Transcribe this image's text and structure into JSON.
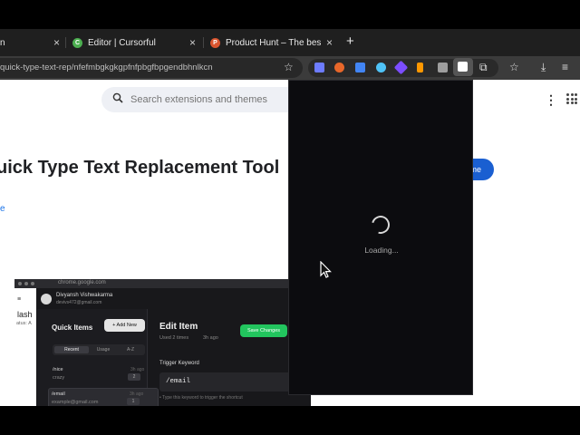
{
  "browser": {
    "tabs": [
      {
        "title": "n",
        "favicon_color": "#888888",
        "favicon_letter": ""
      },
      {
        "title": "Editor | Cursorful",
        "favicon_color": "#4caf50",
        "favicon_letter": "C"
      },
      {
        "title": "Product Hunt – The best new",
        "favicon_color": "#da552f",
        "favicon_letter": "P"
      }
    ],
    "tab_close": "×",
    "new_tab": "+",
    "url": "quick-type-text-rep/nfefmbgkgkgpfnfpbgfbpgendbhnlkcn",
    "star_icon": "☆",
    "toolbar_icons": [
      "puzzle-icon",
      "bookmark-star-icon",
      "download-icon",
      "reading-list-icon"
    ],
    "extensions": [
      {
        "name": "bookmark-ext-icon",
        "color": "#6d7cff"
      },
      {
        "name": "tomato-ext-icon",
        "color": "#e8672a"
      },
      {
        "name": "translate-ext-icon",
        "color": "#4285f4"
      },
      {
        "name": "globe-ext-icon",
        "color": "#4fc3f7"
      },
      {
        "name": "gem-ext-icon",
        "color": "#7c4dff"
      },
      {
        "name": "lock-ext-icon",
        "color": "#ff9800"
      },
      {
        "name": "grid-ext-icon",
        "color": "#9e9e9e"
      },
      {
        "name": "shield-ext-icon",
        "color": "#bdbdbd"
      }
    ]
  },
  "page": {
    "search_placeholder": "Search extensions and themes",
    "kebab": "⋮",
    "title": "uick Type Text Replacement Tool",
    "link_fragment": "e",
    "add_button": "me"
  },
  "embedded": {
    "url": "chrome.google.com",
    "menu": "≡",
    "lash": "lash",
    "atus": "atus: A",
    "user_name": "Divyansh Vishwakarma",
    "user_email": "devivs472@gmail.com",
    "quick_items": "Quick Items",
    "add_new": "+ Add New",
    "filters": [
      "Recent",
      "Usage",
      "A-Z"
    ],
    "items": [
      {
        "keyword": "/nice",
        "value": "crazy",
        "ago": "3h ago",
        "count": "2"
      },
      {
        "keyword": "/email",
        "value": "example@gmail.com",
        "ago": "3h ago",
        "count": "1"
      }
    ],
    "edit_title": "Edit Item",
    "used": "Used 2 times",
    "edited": "3h ago",
    "save": "Save Changes",
    "trigger_label": "Trigger Keyword",
    "trigger_value": "/email",
    "trigger_hint": "• Type this keyword to trigger the shortcut"
  },
  "popup": {
    "loading": "Loading..."
  }
}
